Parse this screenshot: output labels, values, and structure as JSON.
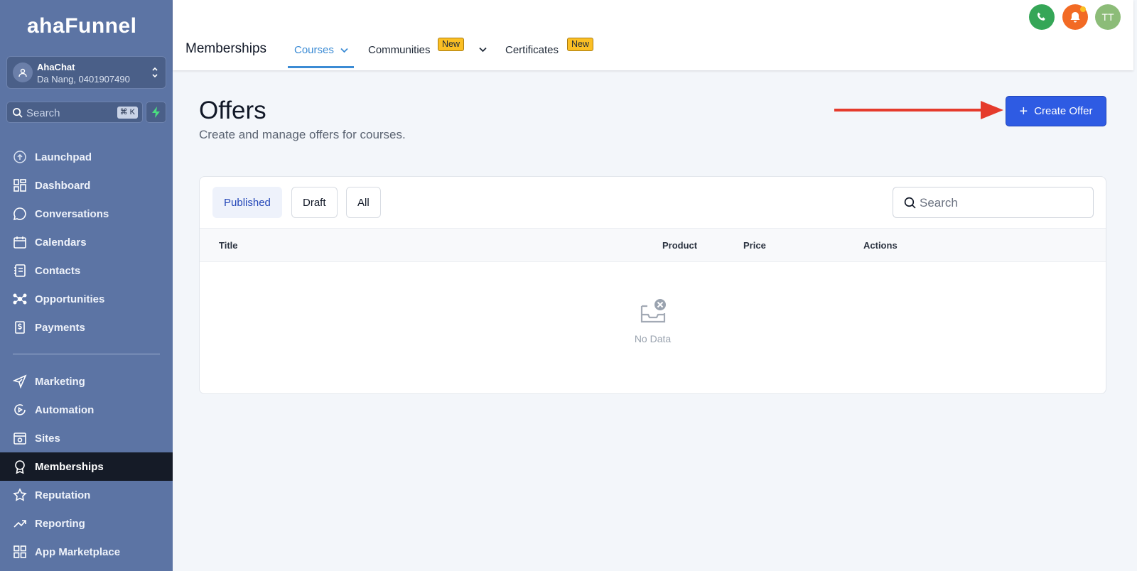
{
  "sidebar": {
    "logo": "ahaFunnel",
    "account": {
      "name": "AhaChat",
      "location": "Da Nang, 0401907490"
    },
    "search": {
      "placeholder": "Search",
      "shortcut": "⌘ K"
    },
    "items": [
      {
        "label": "Launchpad",
        "icon": "launchpad-icon"
      },
      {
        "label": "Dashboard",
        "icon": "dashboard-icon"
      },
      {
        "label": "Conversations",
        "icon": "chat-icon"
      },
      {
        "label": "Calendars",
        "icon": "calendar-icon"
      },
      {
        "label": "Contacts",
        "icon": "contacts-icon"
      },
      {
        "label": "Opportunities",
        "icon": "opportunities-icon"
      },
      {
        "label": "Payments",
        "icon": "payments-icon"
      },
      {
        "label": "Marketing",
        "icon": "send-icon"
      },
      {
        "label": "Automation",
        "icon": "automation-icon"
      },
      {
        "label": "Sites",
        "icon": "sites-icon"
      },
      {
        "label": "Memberships",
        "icon": "award-icon",
        "active": true
      },
      {
        "label": "Reputation",
        "icon": "star-icon"
      },
      {
        "label": "Reporting",
        "icon": "trend-icon"
      },
      {
        "label": "App Marketplace",
        "icon": "grid-icon"
      }
    ]
  },
  "topbar": {
    "title": "Memberships",
    "tabs": [
      {
        "label": "Courses",
        "active": true
      },
      {
        "label": "Communities",
        "badge": "New"
      },
      {
        "label": "Certificates",
        "badge": "New"
      }
    ],
    "user_initials": "TT"
  },
  "main": {
    "title": "Offers",
    "subtitle": "Create and manage offers for courses.",
    "create_button": "Create Offer",
    "filters": [
      "Published",
      "Draft",
      "All"
    ],
    "search_placeholder": "Search",
    "columns": [
      "Title",
      "Product",
      "Price",
      "Actions"
    ],
    "empty_text": "No Data"
  },
  "colors": {
    "sidebar": "#5c74a4",
    "active_nav": "#151b27",
    "primary": "#2e5be3",
    "tab_active": "#3b8bd4",
    "badge": "#fbbf24",
    "arrow": "#e53b2c"
  }
}
